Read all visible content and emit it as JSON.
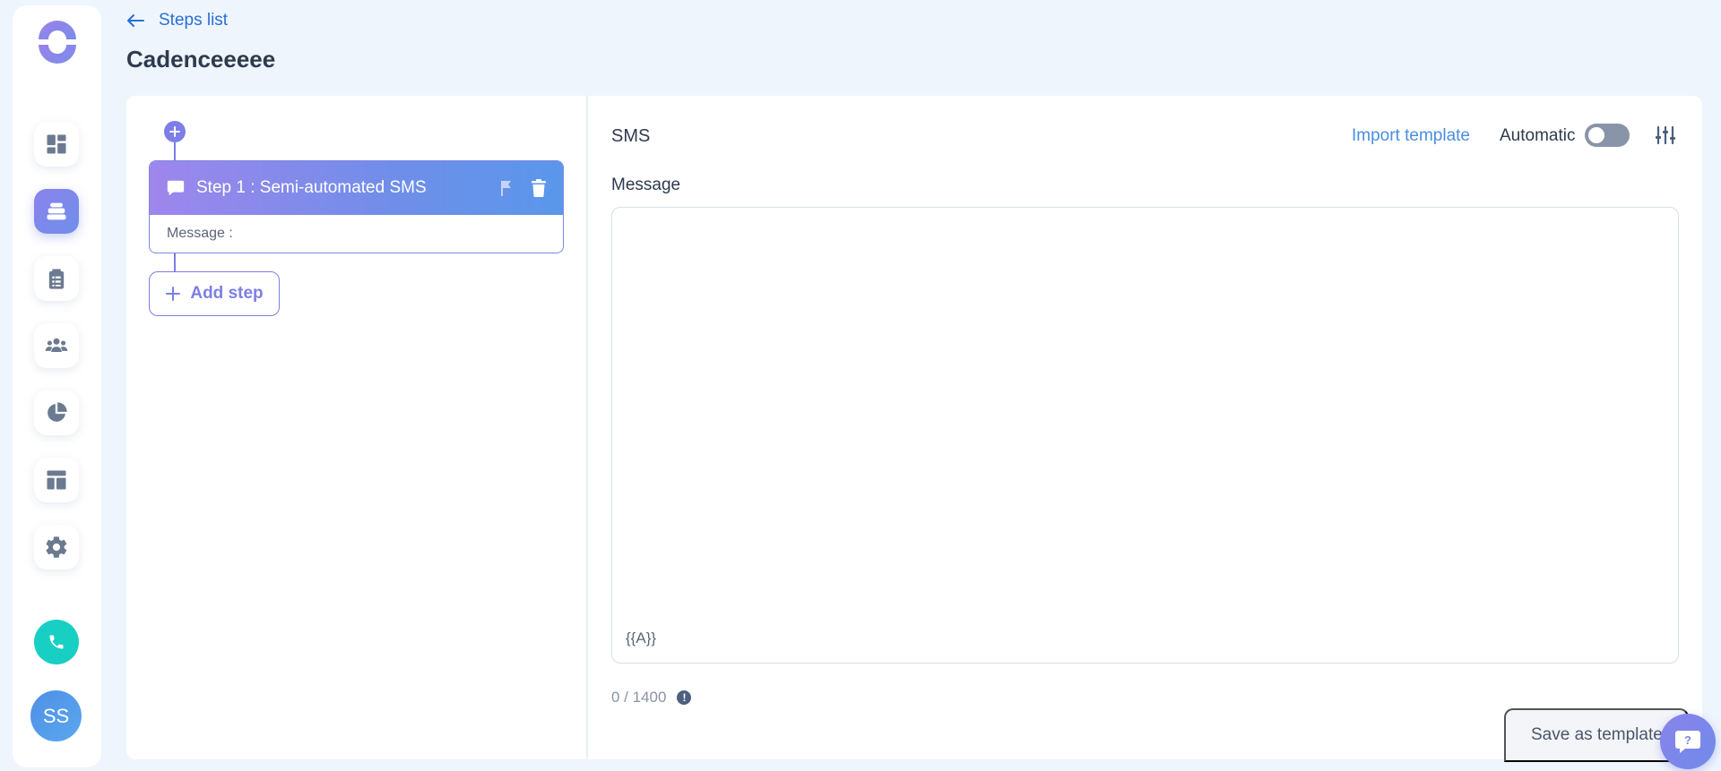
{
  "header": {
    "back_label": "Steps list",
    "title": "Cadenceeeee"
  },
  "sidebar": {
    "items": [
      {
        "icon": "dashboard-icon",
        "active": false
      },
      {
        "icon": "cadence-icon",
        "active": true
      },
      {
        "icon": "clipboard-icon",
        "active": false
      },
      {
        "icon": "users-icon",
        "active": false
      },
      {
        "icon": "pie-chart-icon",
        "active": false
      },
      {
        "icon": "template-icon",
        "active": false
      },
      {
        "icon": "gear-icon",
        "active": false
      }
    ],
    "avatar_initials": "SS"
  },
  "steps": {
    "items": [
      {
        "title": "Step 1 : Semi-automated SMS",
        "body": "Message :"
      }
    ],
    "add_step_label": "Add step"
  },
  "editor": {
    "channel_label": "SMS",
    "import_template_label": "Import template",
    "automatic_label": "Automatic",
    "automatic_enabled": false,
    "message_label": "Message",
    "message_value": "",
    "variable_token": "{{A}}",
    "counter": "0 / 1400",
    "save_template_label": "Save as template"
  },
  "colors": {
    "accent": "#7d7ee7",
    "link": "#2a6fd6",
    "background": "#eef5fd",
    "call": "#18cfc4"
  }
}
